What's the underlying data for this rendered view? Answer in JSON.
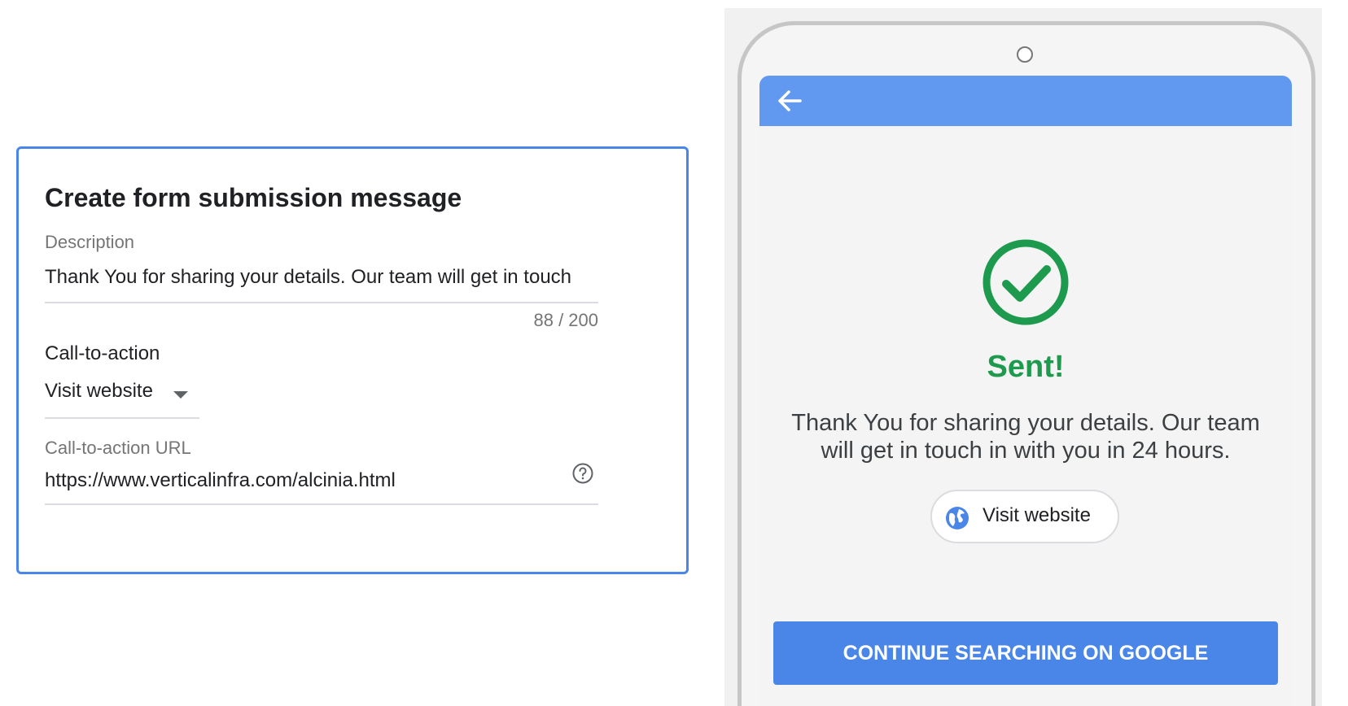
{
  "form": {
    "title": "Create form submission message",
    "description_label": "Description",
    "description_value": "Thank You for sharing your details. Our team will get in touch",
    "char_count": "88 / 200",
    "cta_label": "Call-to-action",
    "cta_selected": "Visit website",
    "cta_url_label": "Call-to-action URL",
    "cta_url_value": "https://www.verticalinfra.com/alcinia.html",
    "help_icon": "help-circle-icon"
  },
  "preview": {
    "back_icon": "arrow-back-icon",
    "check_icon": "check-circle-icon",
    "sent_title": "Sent!",
    "message": "Thank You for sharing your details. Our team will get in touch in with you in 24 hours.",
    "visit_button_label": "Visit website",
    "globe_icon": "globe-icon",
    "continue_button_label": "CONTINUE SEARCHING ON GOOGLE"
  },
  "colors": {
    "accent_blue": "#4a86e8",
    "app_bar_blue": "#6199f0",
    "success_green": "#1e9a4e"
  }
}
